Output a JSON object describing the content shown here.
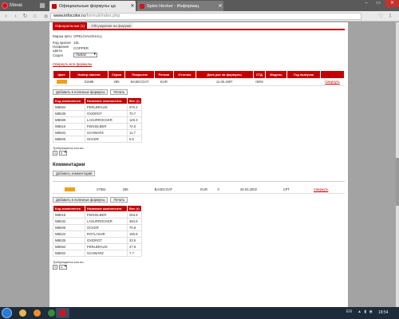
{
  "browser": {
    "menu_label": "Меню",
    "tabs": [
      {
        "title": "Официальные формулы ца",
        "active": true,
        "favicon_color": "#c40000"
      },
      {
        "title": "Spies Hecker - Информац",
        "active": false,
        "favicon_color": "#d2141e"
      }
    ],
    "address": {
      "host": "www.infocolor.ru",
      "path": "/formuli/index.php"
    }
  },
  "page": {
    "subtabs": [
      "Официальные (1)",
      "Обсуждение на форуме"
    ],
    "props": [
      {
        "key": "Марка авто",
        "value": "OPEL/VAUXHALL"
      },
      {
        "key": "Код краски",
        "value": "15L"
      },
      {
        "key": "Название цвета",
        "value": "COPPER"
      }
    ],
    "sediment": {
      "key": "Седел",
      "value": "Любая"
    },
    "all_formulas_link": "Свернуть все формулы",
    "formula_headers": [
      "Цвет",
      "Номер панели",
      "Серия",
      "Покрытие",
      "Регион",
      "Оттенок",
      "Дата раз на формулы",
      "СТД",
      "Модель",
      "Год выпуска",
      ""
    ],
    "formula1": {
      "color": "#f1a014",
      "cells": [
        "01589",
        "295",
        "BASECOAT",
        "EUR",
        "",
        "11.06.1997",
        "OEM",
        "",
        "",
        "Свернуть"
      ]
    },
    "buttons": {
      "add_to_favorites": "Добавить в полезные формулы",
      "print": "Печать"
    },
    "component_headers": [
      "Код компонента",
      "Название компонента",
      "Вес (г)"
    ],
    "components1": [
      [
        "MB564",
        "PERLBRAUN",
        "670.2"
      ],
      [
        "MB535",
        "OXIDROT",
        "70.7"
      ],
      [
        "MB555",
        "LASURROCKER",
        "128.3"
      ],
      [
        "MB516",
        "FEINSILBER",
        "74.5"
      ],
      [
        "MB502",
        "SCHWARZ",
        "11.7"
      ],
      [
        "MB505",
        "OCKER",
        "6.5"
      ]
    ],
    "quantity_label": "Требующееся кол-во",
    "quantity1": {
      "value": "1",
      "unit": "л"
    },
    "comments_title": "Комментарии",
    "add_comment": "Добавить комментарий",
    "formula2": {
      "color": "#f1a014",
      "cells": [
        "07981",
        "295",
        "BASECOAT",
        "EUR",
        "0",
        "26.03.2002",
        "CPT",
        "",
        "",
        "Свернуть"
      ]
    },
    "components2": [
      [
        "MB516",
        "FEINSILBER",
        "253.6"
      ],
      [
        "MB532",
        "LASURROCKER",
        "394.9"
      ],
      [
        "MB505",
        "OCKER",
        "70.9"
      ],
      [
        "MB524",
        "ROTLASUR",
        "156.9"
      ],
      [
        "MB535",
        "OXIDROT",
        "33.5"
      ],
      [
        "MB564",
        "PERLBRAUN",
        "47.9"
      ],
      [
        "MB502",
        "SCHWARZ",
        "7.7"
      ]
    ],
    "quantity2": {
      "value": "1",
      "unit": "л"
    }
  },
  "taskbar": {
    "lang": "EN",
    "time": "18:54"
  }
}
